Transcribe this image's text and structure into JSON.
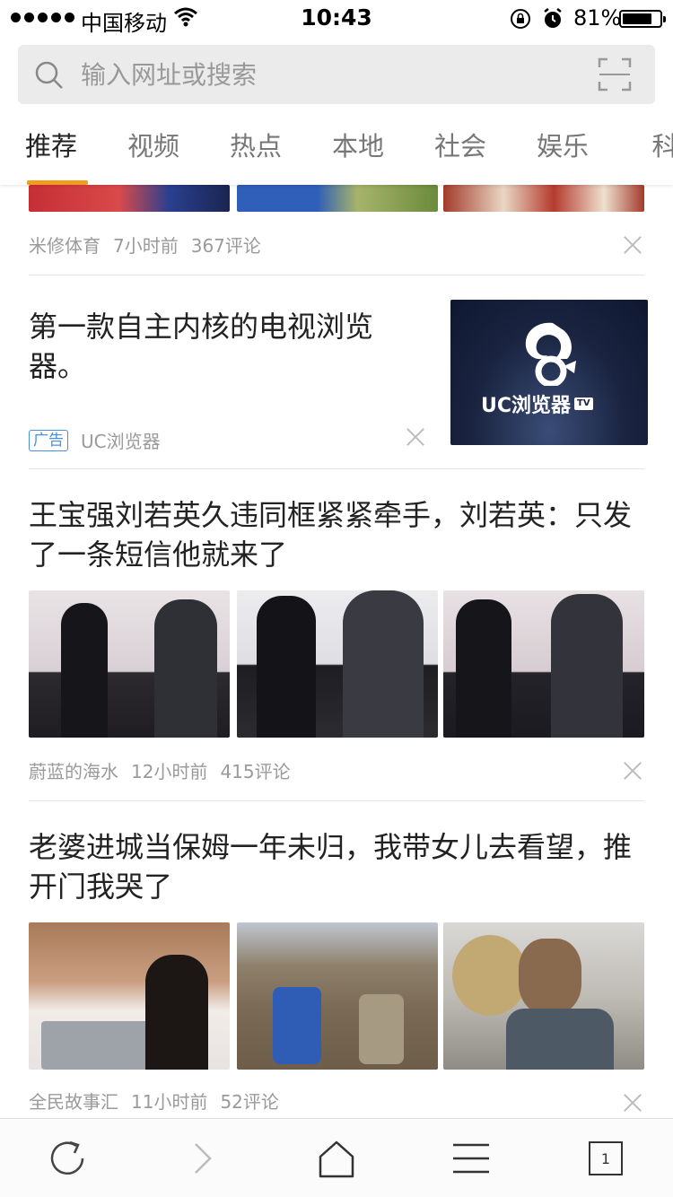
{
  "status_bar": {
    "carrier": "中国移动",
    "time": "10:43",
    "battery_percent": "81%",
    "battery_level": 0.81,
    "icons": [
      "signal-dots-icon",
      "wifi-icon",
      "rotation-lock-icon",
      "alarm-icon",
      "battery-icon"
    ]
  },
  "search": {
    "placeholder": "输入网址或搜索",
    "icons": [
      "search-icon",
      "scan-icon"
    ]
  },
  "tabs": [
    {
      "label": "推荐",
      "active": true
    },
    {
      "label": "视频",
      "active": false
    },
    {
      "label": "热点",
      "active": false
    },
    {
      "label": "本地",
      "active": false
    },
    {
      "label": "社会",
      "active": false
    },
    {
      "label": "娱乐",
      "active": false
    },
    {
      "label": "科",
      "active": false
    }
  ],
  "feed": {
    "item0": {
      "source": "米修体育",
      "time": "7小时前",
      "comments": "367评论"
    },
    "ad": {
      "title": "第一款自主内核的电视浏览器。",
      "badge": "广告",
      "source": "UC浏览器",
      "image_caption": "UC浏览器",
      "image_tv_badge": "TV"
    },
    "item1": {
      "title": "王宝强刘若英久违同框紧紧牵手，刘若英：只发了一条短信他就来了",
      "source": "蔚蓝的海水",
      "time": "12小时前",
      "comments": "415评论"
    },
    "item2": {
      "title": "老婆进城当保姆一年未归，我带女儿去看望，推开门我哭了",
      "source": "全民故事汇",
      "time": "11小时前",
      "comments": "52评论"
    }
  },
  "toolbar": {
    "tabs_count": "1",
    "icons": [
      "refresh-icon",
      "forward-icon",
      "home-icon",
      "menu-icon",
      "tabs-icon"
    ]
  },
  "colors": {
    "accent": "#f39a1f",
    "ad_blue": "#4a90e2"
  }
}
